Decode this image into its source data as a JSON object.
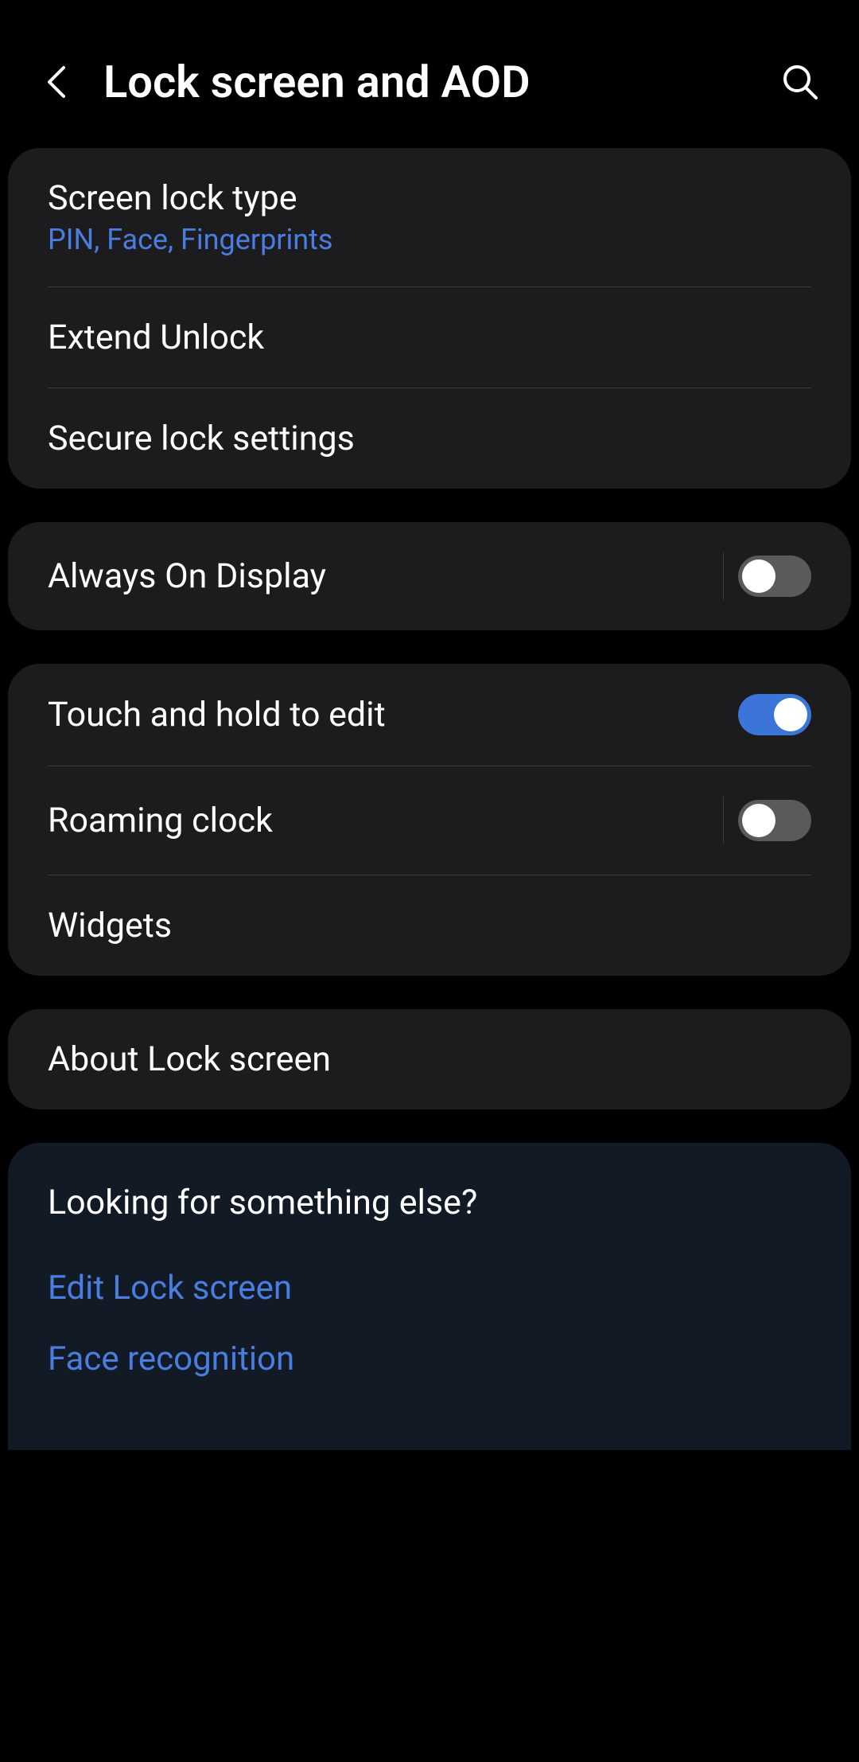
{
  "header": {
    "title": "Lock screen and AOD"
  },
  "section1": {
    "screenLockType": {
      "title": "Screen lock type",
      "subtitle": "PIN, Face, Fingerprints"
    },
    "extendUnlock": {
      "title": "Extend Unlock"
    },
    "secureLockSettings": {
      "title": "Secure lock settings"
    }
  },
  "section2": {
    "alwaysOnDisplay": {
      "title": "Always On Display",
      "enabled": false
    }
  },
  "section3": {
    "touchAndHold": {
      "title": "Touch and hold to edit",
      "enabled": true
    },
    "roamingClock": {
      "title": "Roaming clock",
      "enabled": false
    },
    "widgets": {
      "title": "Widgets"
    }
  },
  "section4": {
    "aboutLockScreen": {
      "title": "About Lock screen"
    }
  },
  "infoSection": {
    "title": "Looking for something else?",
    "links": {
      "editLockScreen": "Edit Lock screen",
      "faceRecognition": "Face recognition"
    }
  }
}
